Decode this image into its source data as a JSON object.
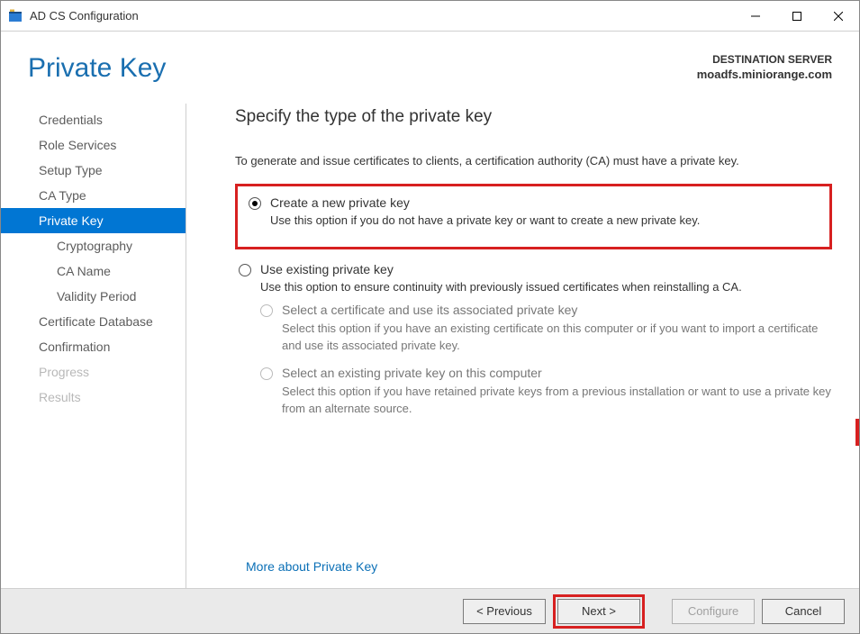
{
  "window": {
    "title": "AD CS Configuration"
  },
  "header": {
    "page_title": "Private Key",
    "dest_label": "DESTINATION SERVER",
    "dest_server": "moadfs.miniorange.com"
  },
  "sidebar": {
    "items": [
      {
        "label": "Credentials",
        "key": "credentials"
      },
      {
        "label": "Role Services",
        "key": "role-services"
      },
      {
        "label": "Setup Type",
        "key": "setup-type"
      },
      {
        "label": "CA Type",
        "key": "ca-type"
      },
      {
        "label": "Private Key",
        "key": "private-key",
        "selected": true
      },
      {
        "label": "Cryptography",
        "key": "cryptography",
        "sub": true
      },
      {
        "label": "CA Name",
        "key": "ca-name",
        "sub": true
      },
      {
        "label": "Validity Period",
        "key": "validity-period",
        "sub": true
      },
      {
        "label": "Certificate Database",
        "key": "cert-db"
      },
      {
        "label": "Confirmation",
        "key": "confirmation"
      },
      {
        "label": "Progress",
        "key": "progress",
        "disabled": true
      },
      {
        "label": "Results",
        "key": "results",
        "disabled": true
      }
    ]
  },
  "content": {
    "heading": "Specify the type of the private key",
    "intro": "To generate and issue certificates to clients, a certification authority (CA) must have a private key.",
    "options": {
      "create": {
        "label": "Create a new private key",
        "desc": "Use this option if you do not have a private key or want to create a new private key."
      },
      "existing": {
        "label": "Use existing private key",
        "desc": "Use this option to ensure continuity with previously issued certificates when reinstalling a CA.",
        "sub": {
          "select_cert": {
            "label": "Select a certificate and use its associated private key",
            "desc": "Select this option if you have an existing certificate on this computer or if you want to import a certificate and use its associated private key."
          },
          "select_key": {
            "label": "Select an existing private key on this computer",
            "desc": "Select this option if you have retained private keys from a previous installation or want to use a private key from an alternate source."
          }
        }
      }
    },
    "more_link": "More about Private Key"
  },
  "buttons": {
    "previous": "< Previous",
    "next": "Next >",
    "configure": "Configure",
    "cancel": "Cancel"
  }
}
